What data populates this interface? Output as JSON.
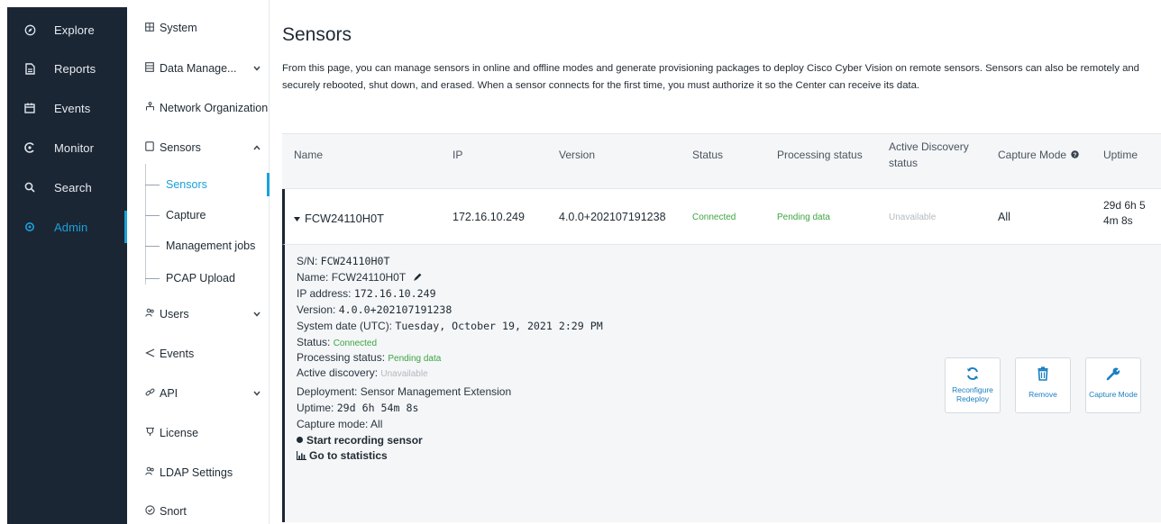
{
  "nav": {
    "items": [
      {
        "label": "Explore",
        "icon": "compass-icon"
      },
      {
        "label": "Reports",
        "icon": "document-icon"
      },
      {
        "label": "Events",
        "icon": "calendar-icon"
      },
      {
        "label": "Monitor",
        "icon": "monitor-icon"
      },
      {
        "label": "Search",
        "icon": "search-icon"
      },
      {
        "label": "Admin",
        "icon": "gear-icon"
      }
    ],
    "active": "Admin",
    "accent": "#1aa1d9",
    "background": "#1b2635"
  },
  "admin_menu": {
    "system": "System",
    "data_management": "Data Manage...",
    "network_organization": "Network Organization",
    "sensors": "Sensors",
    "sensors_children": [
      "Sensors",
      "Capture",
      "Management jobs",
      "PCAP Upload"
    ],
    "users": "Users",
    "events": "Events",
    "api": "API",
    "license": "License",
    "ldap": "LDAP Settings",
    "snort": "Snort"
  },
  "page": {
    "title": "Sensors",
    "intro": "From this page, you can manage sensors in online and offline modes and generate provisioning packages to deploy Cisco Cyber Vision on remote sensors. Sensors can also be remotely and securely rebooted, shut down, and erased. When a sensor connects for the first time, you must authorize it so the Center can receive its data."
  },
  "table": {
    "headers": {
      "name": "Name",
      "ip": "IP",
      "version": "Version",
      "status": "Status",
      "processing": "Processing status",
      "discovery_1": "Active Discovery",
      "discovery_2": "status",
      "capture": "Capture Mode",
      "uptime": "Uptime"
    },
    "row": {
      "name": "FCW24110H0T",
      "ip": "172.16.10.249",
      "version": "4.0.0+202107191238",
      "status": "Connected",
      "processing": "Pending data",
      "discovery": "Unavailable",
      "capture": "All",
      "uptime_1": "29d 6h 5",
      "uptime_2": "4m 8s"
    }
  },
  "detail": {
    "sn_label": "S/N: ",
    "sn_value": "FCW24110H0T",
    "name_label": "Name: ",
    "name_value": "FCW24110H0T",
    "ip_label": "IP address: ",
    "ip_value": "172.16.10.249",
    "version_label": "Version: ",
    "version_value": "4.0.0+202107191238",
    "date_label": "System date (UTC): ",
    "date_value": "Tuesday, October 19, 2021 2:29 PM",
    "status_label": "Status: ",
    "status_value": "Connected",
    "processing_label": "Processing status: ",
    "processing_value": "Pending data",
    "discovery_label": "Active discovery: ",
    "discovery_value": "Unavailable",
    "deployment": "Deployment: Sensor Management Extension",
    "uptime_label": "Uptime: ",
    "uptime_value": "29d 6h 54m 8s",
    "capture": "Capture mode: All",
    "start_recording": "Start recording sensor",
    "statistics": "Go to statistics"
  },
  "actions": {
    "reconfigure_1": "Reconfigure",
    "reconfigure_2": "Redeploy",
    "remove": "Remove",
    "capture_mode": "Capture Mode"
  },
  "colors": {
    "connected": "#3ea541",
    "pending": "#3ea541",
    "unavailable": "#b3bac1",
    "link": "#1a7fc1"
  }
}
